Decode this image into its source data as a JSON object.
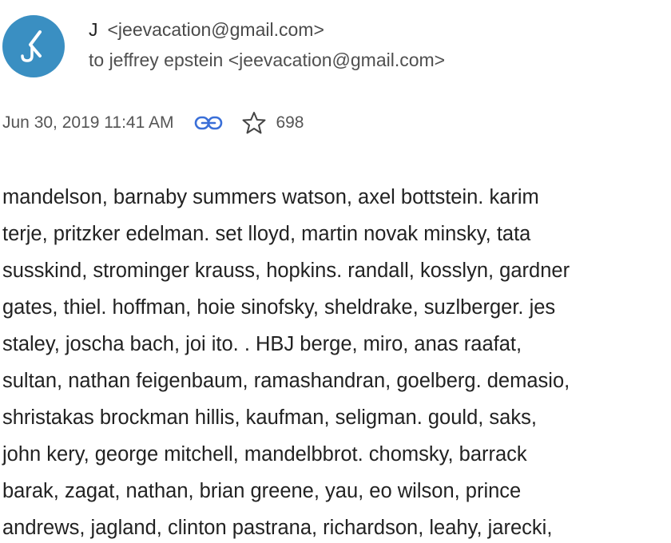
{
  "sender": {
    "initial": "J",
    "email": "<jeevacation@gmail.com>"
  },
  "recipient": "to jeffrey epstein <jeevacation@gmail.com>",
  "meta": {
    "date": "Jun 30, 2019 11:41 AM",
    "count": "698"
  },
  "icons": {
    "avatar": "avatar-logo",
    "link": "link-icon",
    "star": "star-icon"
  },
  "colors": {
    "avatar_bg": "#3a8fc2"
  },
  "body_lines": [
    "mandelson, barnaby summers watson, axel bottstein. karim",
    "terje, pritzker edelman. set lloyd, martin novak minsky, tata",
    "susskind, strominger krauss, hopkins. randall, kosslyn, gardner",
    "gates, thiel. hoffman, hoie sinofsky, sheldrake, suzlberger. jes",
    "staley, joscha bach, joi ito. . HBJ berge, miro, anas raafat,",
    "sultan, nathan feigenbaum, ramashandran, goelberg. demasio,",
    "shristakas brockman hillis, kaufman, seligman. gould, saks,",
    "john kery, george mitchell, mandelbbrot. chomsky, barrack",
    "barak, zagat, nathan, brian greene, yau, eo wilson, prince",
    "andrews, jagland, clinton pastrana, richardson, leahy, jarecki,"
  ]
}
